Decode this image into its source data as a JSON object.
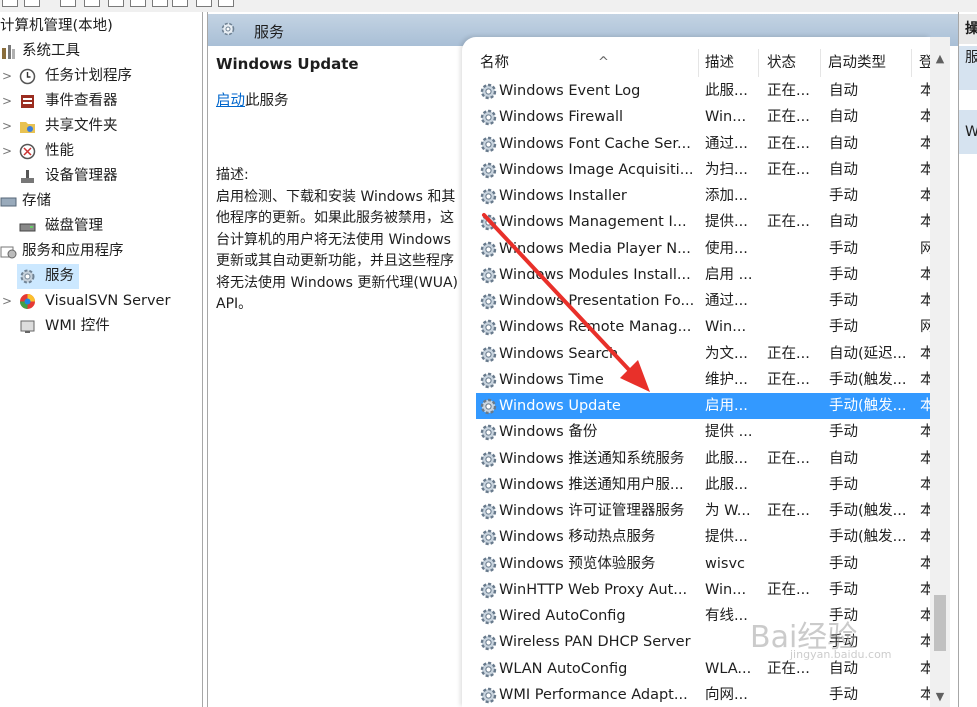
{
  "tree": {
    "items": [
      {
        "label": "计算机管理(本地)",
        "icon": "computer-management-icon"
      },
      {
        "label": "系统工具",
        "icon": "tools-icon"
      },
      {
        "label": "任务计划程序",
        "icon": "clock-icon"
      },
      {
        "label": "事件查看器",
        "icon": "event-viewer-icon"
      },
      {
        "label": "共享文件夹",
        "icon": "shared-folder-icon"
      },
      {
        "label": "性能",
        "icon": "performance-icon"
      },
      {
        "label": "设备管理器",
        "icon": "device-manager-icon"
      },
      {
        "label": "存储",
        "icon": "storage-icon"
      },
      {
        "label": "磁盘管理",
        "icon": "disk-icon"
      },
      {
        "label": "服务和应用程序",
        "icon": "services-apps-icon"
      },
      {
        "label": "服务",
        "icon": "gear-icon"
      },
      {
        "label": "VisualSVN Server",
        "icon": "visualsvn-icon"
      },
      {
        "label": "WMI 控件",
        "icon": "wmi-icon"
      }
    ]
  },
  "header": {
    "title": "服务"
  },
  "detail": {
    "service_name": "Windows Update",
    "start_link": "启动",
    "start_suffix": "此服务",
    "desc_label": "描述:",
    "desc_text": "启用检测、下载和安装 Windows 和其他程序的更新。如果此服务被禁用，这台计算机的用户将无法使用 Windows 更新或其自动更新功能，并且这些程序将无法使用 Windows 更新代理(WUA) API。"
  },
  "columns": {
    "name": "名称",
    "desc": "描述",
    "status": "状态",
    "startup": "启动类型",
    "logon": "登"
  },
  "rows": [
    {
      "name": "Windows Event Log",
      "desc": "此服...",
      "status": "正在...",
      "startup": "自动",
      "logon": "本"
    },
    {
      "name": "Windows Firewall",
      "desc": "Win...",
      "status": "正在...",
      "startup": "自动",
      "logon": "本"
    },
    {
      "name": "Windows Font Cache Ser...",
      "desc": "通过...",
      "status": "正在...",
      "startup": "自动",
      "logon": "本"
    },
    {
      "name": "Windows Image Acquisiti...",
      "desc": "为扫...",
      "status": "正在...",
      "startup": "自动",
      "logon": "本"
    },
    {
      "name": "Windows Installer",
      "desc": "添加...",
      "status": "",
      "startup": "手动",
      "logon": "本"
    },
    {
      "name": "Windows Management I...",
      "desc": "提供...",
      "status": "正在...",
      "startup": "自动",
      "logon": "本"
    },
    {
      "name": "Windows Media Player N...",
      "desc": "使用...",
      "status": "",
      "startup": "手动",
      "logon": "网"
    },
    {
      "name": "Windows Modules Install...",
      "desc": "启用 ...",
      "status": "",
      "startup": "手动",
      "logon": "本"
    },
    {
      "name": "Windows Presentation Fo...",
      "desc": "通过...",
      "status": "",
      "startup": "手动",
      "logon": "本"
    },
    {
      "name": "Windows Remote Manag...",
      "desc": "Win...",
      "status": "",
      "startup": "手动",
      "logon": "网"
    },
    {
      "name": "Windows Search",
      "desc": "为文...",
      "status": "正在...",
      "startup": "自动(延迟...",
      "logon": "本"
    },
    {
      "name": "Windows Time",
      "desc": "维护...",
      "status": "正在...",
      "startup": "手动(触发...",
      "logon": "本"
    },
    {
      "name": "Windows Update",
      "desc": "启用...",
      "status": "",
      "startup": "手动(触发...",
      "logon": "本",
      "selected": true
    },
    {
      "name": "Windows 备份",
      "desc": "提供 ...",
      "status": "",
      "startup": "手动",
      "logon": "本"
    },
    {
      "name": "Windows 推送通知系统服务",
      "desc": "此服...",
      "status": "正在...",
      "startup": "自动",
      "logon": "本"
    },
    {
      "name": "Windows 推送通知用户服...",
      "desc": "此服...",
      "status": "",
      "startup": "手动",
      "logon": "本"
    },
    {
      "name": "Windows 许可证管理器服务",
      "desc": "为 W...",
      "status": "正在...",
      "startup": "手动(触发...",
      "logon": "本"
    },
    {
      "name": "Windows 移动热点服务",
      "desc": "提供...",
      "status": "",
      "startup": "手动(触发...",
      "logon": "本"
    },
    {
      "name": "Windows 预览体验服务",
      "desc": "wisvc",
      "status": "",
      "startup": "手动",
      "logon": "本"
    },
    {
      "name": "WinHTTP Web Proxy Aut...",
      "desc": "Win...",
      "status": "正在...",
      "startup": "手动",
      "logon": "本"
    },
    {
      "name": "Wired AutoConfig",
      "desc": "有线...",
      "status": "",
      "startup": "手动",
      "logon": "本"
    },
    {
      "name": "Wireless PAN DHCP Server",
      "desc": "",
      "status": "",
      "startup": "手动",
      "logon": "本"
    },
    {
      "name": "WLAN AutoConfig",
      "desc": "WLA...",
      "status": "正在...",
      "startup": "自动",
      "logon": "本"
    },
    {
      "name": "WMI Performance Adapt...",
      "desc": "向网...",
      "status": "",
      "startup": "手动",
      "logon": "本"
    }
  ],
  "actions": {
    "header": "操",
    "item1": "服",
    "item2": "W"
  },
  "watermark": {
    "text": "Bai经验",
    "url": "jingyan.baidu.com"
  },
  "colors": {
    "selection": "#3399ff",
    "header_band": "#b6c9dc",
    "annotation_arrow": "#e8302a"
  }
}
